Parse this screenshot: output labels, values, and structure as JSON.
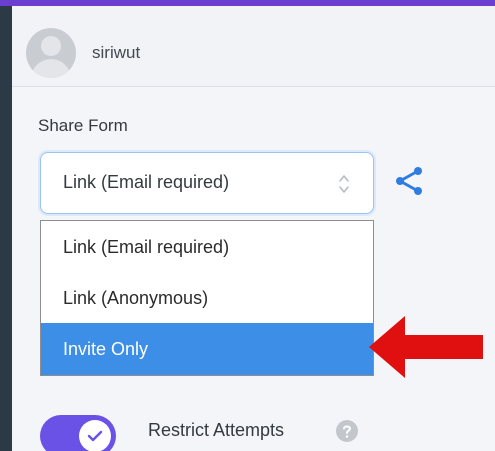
{
  "user": {
    "name": "siriwut"
  },
  "share_form": {
    "title": "Share Form",
    "selected_value": "Link (Email required)",
    "options": [
      "Link (Email required)",
      "Link (Anonymous)",
      "Invite Only"
    ],
    "highlighted_option": "Invite Only"
  },
  "settings": {
    "restrict_attempts_label": "Restrict Attempts",
    "restrict_attempts_enabled": true
  },
  "icons": {
    "avatar": "user-avatar-placeholder",
    "select_stepper": "chevron-updown-icon",
    "share": "share-icon",
    "help": "question-icon",
    "annotation": "red-arrow-icon"
  },
  "colors": {
    "accent_purple": "#6b52e6",
    "top_strip": "#6a3fd0",
    "highlight_blue": "#3d8ee6",
    "share_icon_blue": "#2f7de1",
    "annotation_red": "#e01010"
  }
}
